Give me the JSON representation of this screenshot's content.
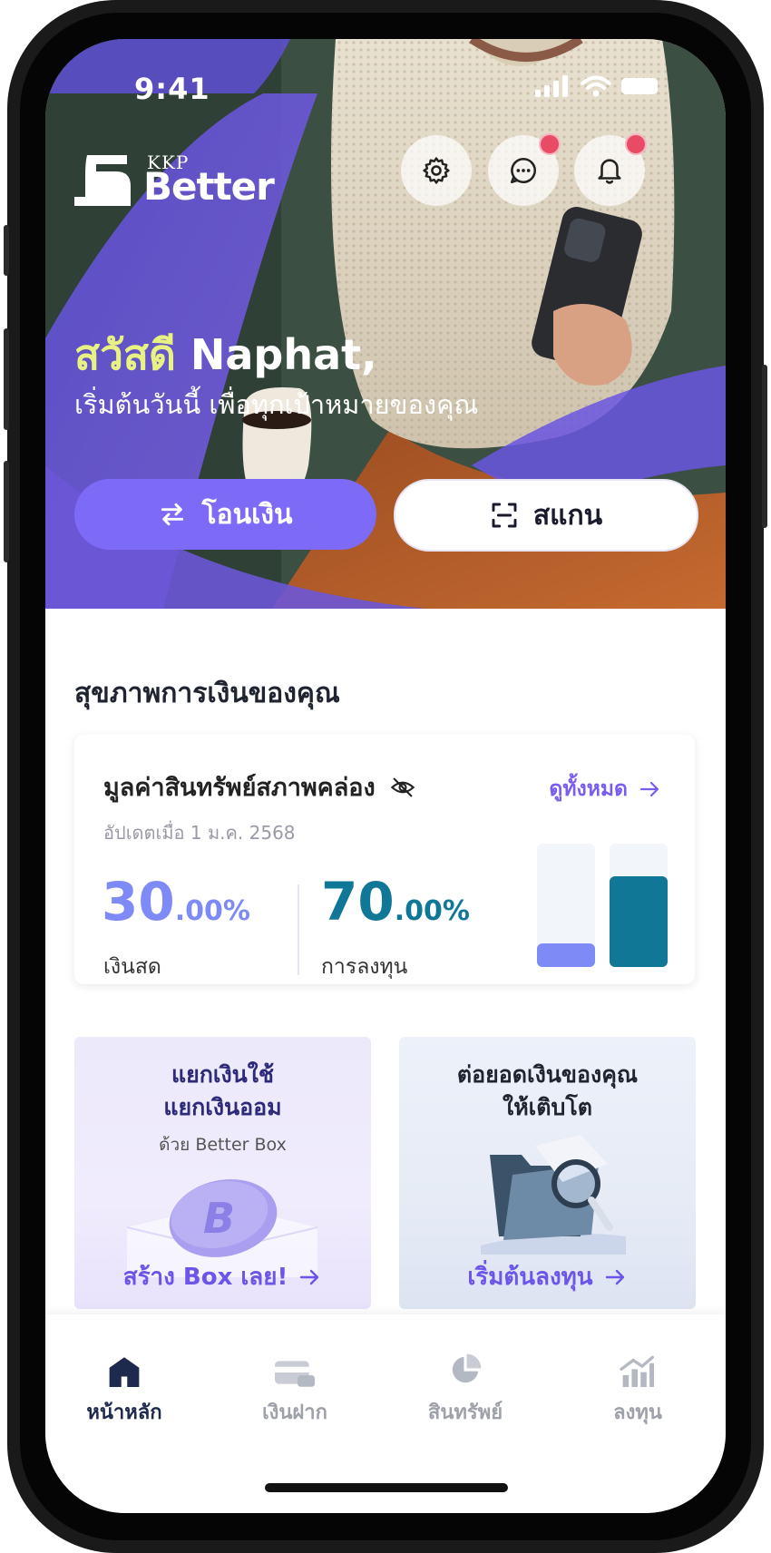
{
  "status_bar": {
    "time": "9:41"
  },
  "header": {
    "logo": {
      "small_text": "KKP",
      "big_text": "Better"
    },
    "buttons": [
      {
        "name": "settings",
        "icon": "gear-icon",
        "has_badge": false
      },
      {
        "name": "messages",
        "icon": "chat-icon",
        "has_badge": true
      },
      {
        "name": "notifications",
        "icon": "bell-icon",
        "has_badge": true
      }
    ]
  },
  "greeting": {
    "hello": "สวัสดี",
    "name": "Naphat,",
    "subtitle": "เริ่มต้นวันนี้ เพื่อทุกเป้าหมายของคุณ"
  },
  "actions": {
    "transfer_label": "โอนเงิน",
    "scan_label": "สแกน"
  },
  "financial_health": {
    "section_title": "สุขภาพการเงินของคุณ",
    "card_title": "มูลค่าสินทรัพย์สภาพคล่อง",
    "view_all": "ดูทั้งหมด",
    "updated": "อัปเดตเมื่อ 1 ม.ค. 2568",
    "cash": {
      "int": "30",
      "dec": ".00%",
      "label": "เงินสด",
      "value": 30,
      "color": "#7e8af5"
    },
    "invest": {
      "int": "70",
      "dec": ".00%",
      "label": "การลงทุน",
      "value": 70,
      "color": "#117797"
    }
  },
  "promos": [
    {
      "title_line1": "แยกเงินใช้",
      "title_line2": "แยกเงินออม",
      "subtitle": "ด้วย Better Box",
      "cta": "สร้าง Box เลย!"
    },
    {
      "title_line1": "ต่อยอดเงินของคุณ",
      "title_line2": "ให้เติบโต",
      "cta": "เริ่มต้นลงทุน"
    }
  ],
  "bottom_nav": [
    {
      "label": "หน้าหลัก",
      "icon": "home-icon",
      "active": true
    },
    {
      "label": "เงินฝาก",
      "icon": "deposit-card-icon",
      "active": false
    },
    {
      "label": "สินทรัพย์",
      "icon": "pie-chart-icon",
      "active": false
    },
    {
      "label": "ลงทุน",
      "icon": "bar-chart-up-icon",
      "active": false
    }
  ]
}
